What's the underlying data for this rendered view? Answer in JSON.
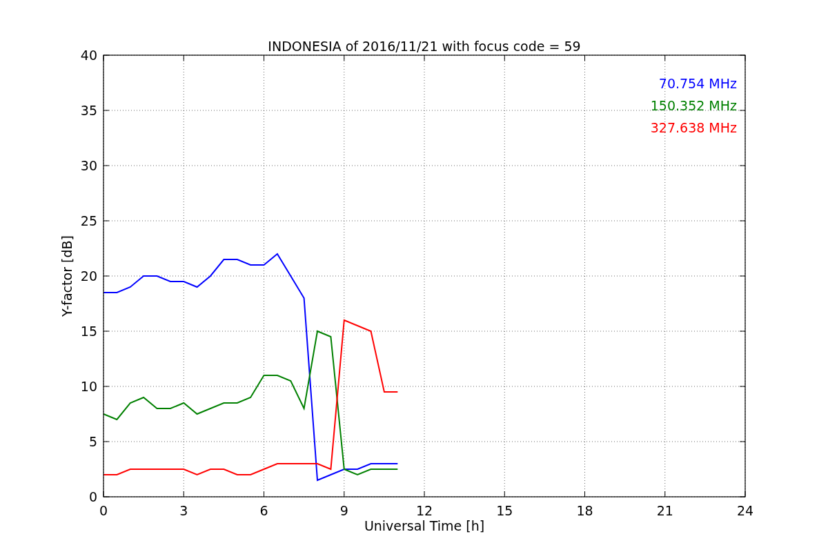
{
  "chart_data": {
    "type": "line",
    "title": "INDONESIA of 2016/11/21 with focus code = 59",
    "xlabel": "Universal Time [h]",
    "ylabel": "Y-factor [dB]",
    "x": [
      0,
      0.5,
      1,
      1.5,
      2,
      2.5,
      3,
      3.5,
      4,
      4.5,
      5,
      5.5,
      6,
      6.5,
      7,
      7.5,
      8,
      8.5,
      9,
      9.5,
      10,
      10.5,
      11
    ],
    "series": [
      {
        "name": "70.754 MHz",
        "color": "#0000ff",
        "values": [
          18.5,
          18.5,
          19,
          20,
          20,
          19.5,
          19.5,
          19,
          20,
          21.5,
          21.5,
          21,
          21,
          22,
          20,
          18,
          1.5,
          2,
          2.5,
          2.5,
          3,
          3,
          3
        ]
      },
      {
        "name": "150.352 MHz",
        "color": "#008000",
        "values": [
          7.5,
          7,
          8.5,
          9,
          8,
          8,
          8.5,
          7.5,
          8,
          8.5,
          8.5,
          9,
          11,
          11,
          10.5,
          8,
          15,
          14.5,
          2.5,
          2,
          2.5,
          2.5,
          2.5
        ]
      },
      {
        "name": "327.638 MHz",
        "color": "#ff0000",
        "values": [
          2,
          2,
          2.5,
          2.5,
          2.5,
          2.5,
          2.5,
          2,
          2.5,
          2.5,
          2,
          2,
          2.5,
          3,
          3,
          3,
          3,
          2.5,
          16,
          15.5,
          15,
          9.5,
          9.5
        ]
      }
    ],
    "xlim": [
      0,
      24
    ],
    "ylim": [
      0,
      40
    ],
    "xticks": [
      0,
      3,
      6,
      9,
      12,
      15,
      18,
      21,
      24
    ],
    "yticks": [
      0,
      5,
      10,
      15,
      20,
      25,
      30,
      35,
      40
    ],
    "grid": true
  }
}
